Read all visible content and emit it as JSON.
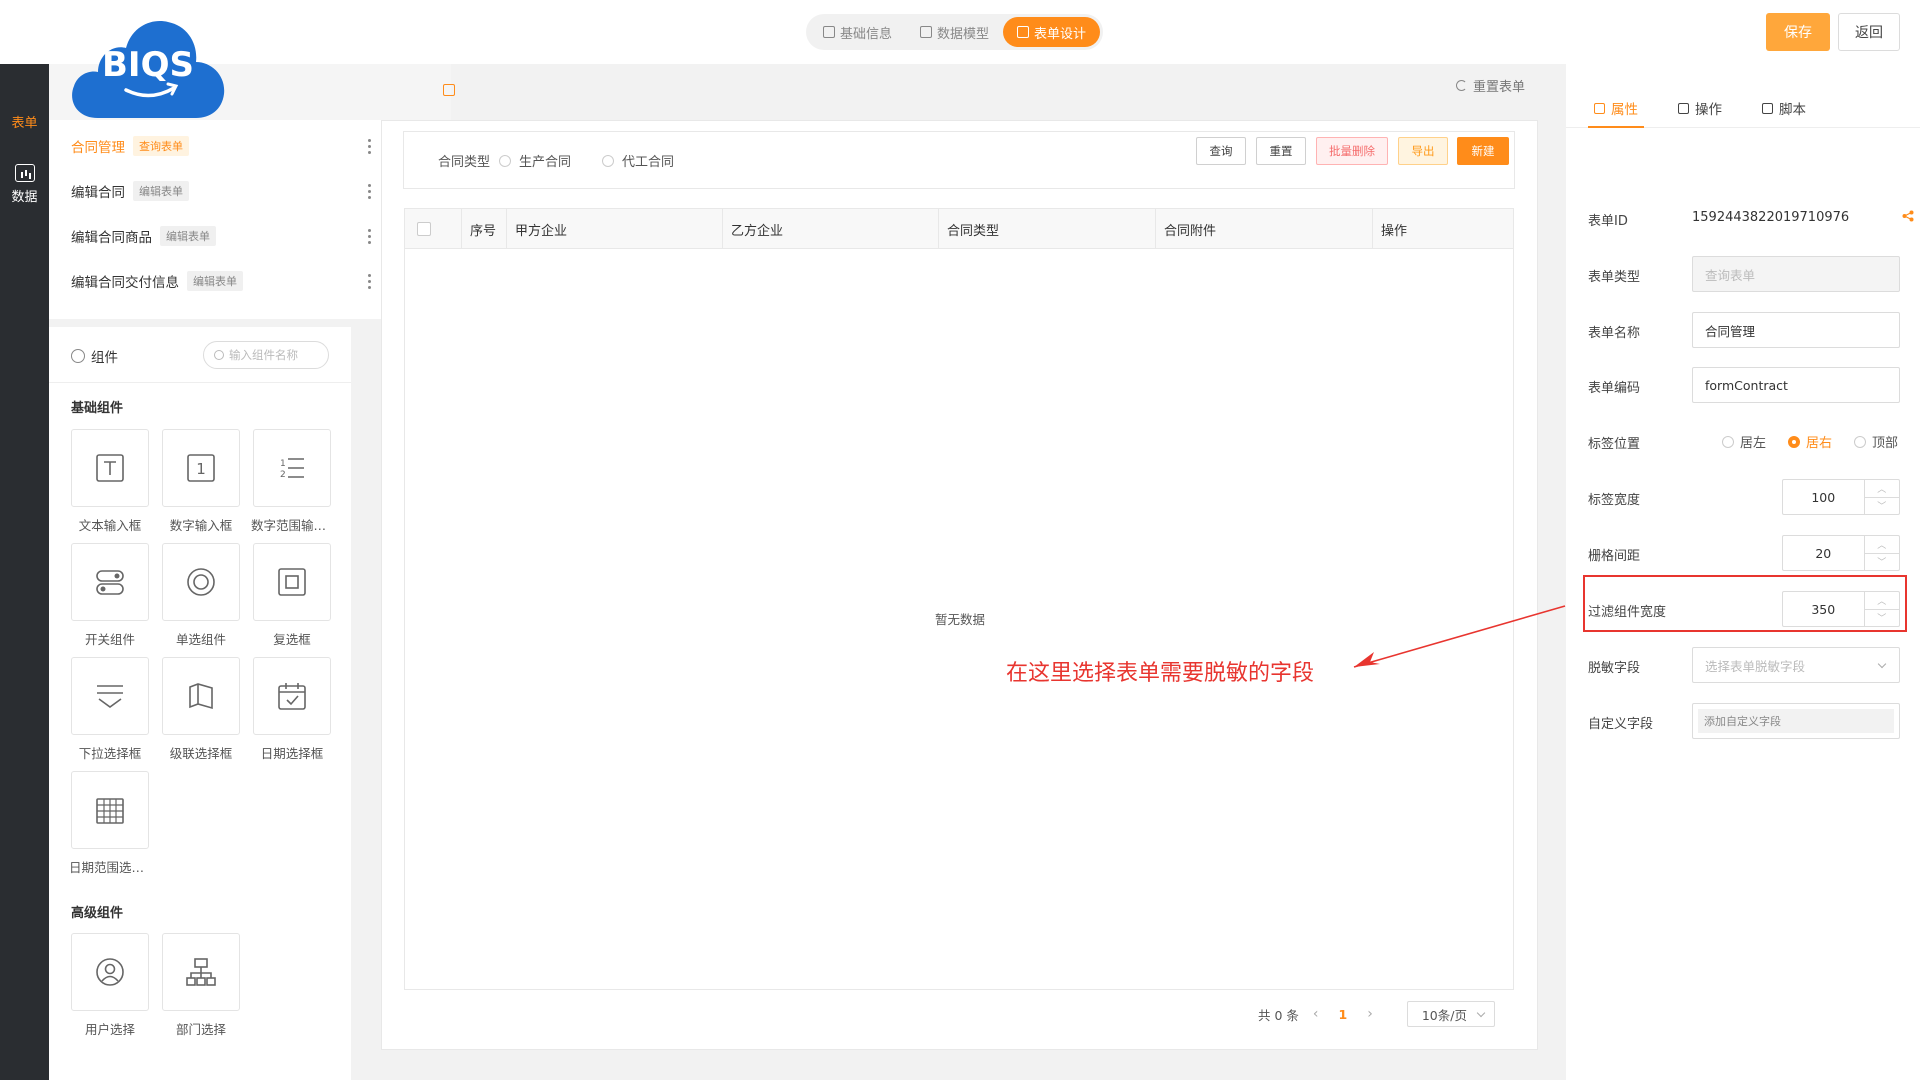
{
  "header": {
    "steps": [
      {
        "label": "基础信息",
        "active": false
      },
      {
        "label": "数据模型",
        "active": false
      },
      {
        "label": "表单设计",
        "active": true
      }
    ],
    "save_label": "保存",
    "back_label": "返回"
  },
  "logo": {
    "text": "BIQS"
  },
  "rail": {
    "top_label": "表单",
    "data_label": "数据"
  },
  "form_list": {
    "items": [
      {
        "name": "合同管理",
        "badge": "查询表单",
        "active": true
      },
      {
        "name": "编辑合同",
        "badge": "编辑表单",
        "active": false
      },
      {
        "name": "编辑合同商品",
        "badge": "编辑表单",
        "active": false
      },
      {
        "name": "编辑合同交付信息",
        "badge": "编辑表单",
        "active": false
      }
    ]
  },
  "components": {
    "title": "组件",
    "search_placeholder": "输入组件名称",
    "basic_title": "基础组件",
    "basic": [
      {
        "label": "文本输入框",
        "icon": "text-input-icon"
      },
      {
        "label": "数字输入框",
        "icon": "number-input-icon"
      },
      {
        "label": "数字范围输入框",
        "icon": "number-range-icon"
      },
      {
        "label": "开关组件",
        "icon": "switch-icon"
      },
      {
        "label": "单选组件",
        "icon": "radio-icon"
      },
      {
        "label": "复选框",
        "icon": "checkbox-icon"
      },
      {
        "label": "下拉选择框",
        "icon": "dropdown-icon"
      },
      {
        "label": "级联选择框",
        "icon": "cascader-icon"
      },
      {
        "label": "日期选择框",
        "icon": "date-icon"
      },
      {
        "label": "日期范围选择框",
        "icon": "date-range-icon"
      }
    ],
    "advanced_title": "高级组件",
    "advanced": [
      {
        "label": "用户选择",
        "icon": "user-icon"
      },
      {
        "label": "部门选择",
        "icon": "org-icon"
      }
    ]
  },
  "canvas": {
    "reset_label": "重置表单",
    "filter": {
      "label": "合同类型",
      "options": [
        "生产合同",
        "代工合同"
      ],
      "buttons": {
        "query": "查询",
        "reset": "重置",
        "batch_delete": "批量删除",
        "export": "导出",
        "create": "新建"
      }
    },
    "table": {
      "columns": [
        "序号",
        "甲方企业",
        "乙方企业",
        "合同类型",
        "合同附件",
        "操作"
      ],
      "empty_text": "暂无数据"
    },
    "pager": {
      "total": "共 0 条",
      "current": "1",
      "size": "10条/页"
    }
  },
  "annotation": {
    "text": "在这里选择表单需要脱敏的字段",
    "color": "#e8352f"
  },
  "props": {
    "tabs": [
      "属性",
      "操作",
      "脚本"
    ],
    "form_id_label": "表单ID",
    "form_id": "1592443822019710976",
    "form_type_label": "表单类型",
    "form_type_placeholder": "查询表单",
    "form_name_label": "表单名称",
    "form_name": "合同管理",
    "form_code_label": "表单编码",
    "form_code": "formContract",
    "label_pos_label": "标签位置",
    "label_pos_options": [
      "居左",
      "居右",
      "顶部"
    ],
    "label_pos_selected": "居右",
    "label_width_label": "标签宽度",
    "label_width": "100",
    "gutter_label": "栅格间距",
    "gutter": "20",
    "filter_width_label": "过滤组件宽度",
    "filter_width": "350",
    "mask_label": "脱敏字段",
    "mask_placeholder": "选择表单脱敏字段",
    "custom_label": "自定义字段",
    "custom_button": "添加自定义字段"
  },
  "colors": {
    "accent": "#ff8c1a",
    "danger": "#f56c6c",
    "annotation": "#e8352f"
  }
}
